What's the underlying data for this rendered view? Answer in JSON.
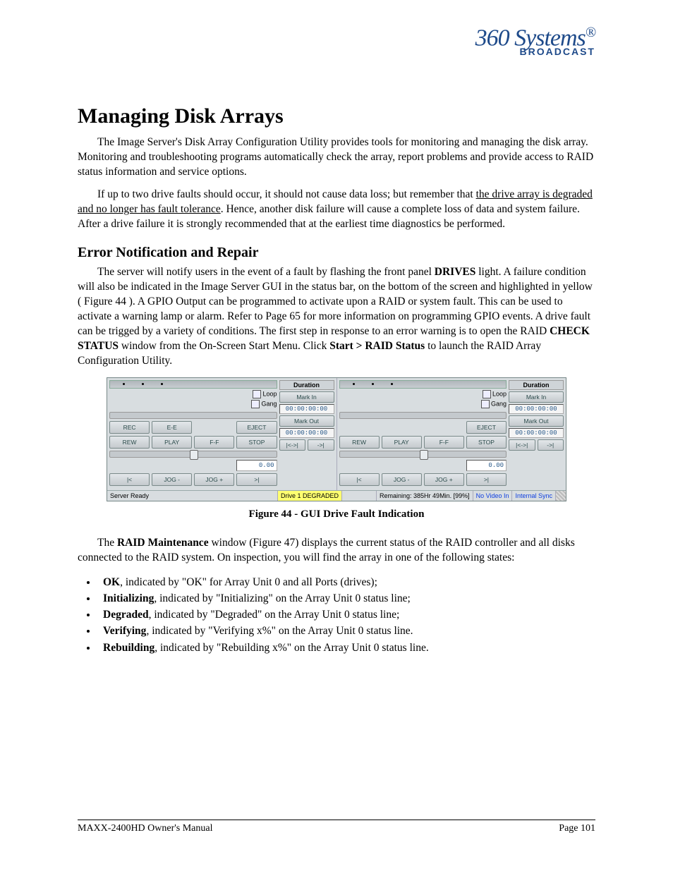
{
  "logo": {
    "script": "360 Systems",
    "reg": "®",
    "broadcast": "BROADCAST"
  },
  "h1": "Managing Disk Arrays",
  "p1a": "The Image Server's Disk Array Configuration Utility provides tools for monitoring and managing the disk array.  Monitoring and troubleshooting programs automatically check the array, report problems and provide access to RAID status information and service options.",
  "p2a": "If up to two drive faults should occur, it should not cause data loss; but remember that ",
  "p2u": "the drive array is degraded and no longer has fault tolerance",
  "p2b": ".  Hence, another disk failure will cause a complete loss of data and system failure.  After a drive failure it is strongly recommended that at the earliest time diagnostics be performed.",
  "h2": "Error Notification and Repair",
  "p3a": "The server will notify users in the event of a fault by flashing the front panel ",
  "p3b1": "DRIVES",
  "p3c": " light.  A failure condition will also be indicated in the Image Server GUI in the status bar, on the bottom of the screen and highlighted in yellow ( Figure 44 ).  A GPIO Output can be programmed to activate upon a RAID or system fault. This can be used to activate a warning lamp or alarm. Refer to Page 65 for more information on programming GPIO events. A drive fault can be trigged by a variety of conditions.  The first step in response to an error warning is to open the RAID ",
  "p3b2": "CHECK STATUS",
  "p3d": " window from the On-Screen Start Menu.  Click ",
  "p3b3": "Start  >  RAID Status",
  "p3e": " to launch the RAID Array Configuration Utility.",
  "fig_caption": "Figure 44 - GUI Drive Fault Indication",
  "gui": {
    "duration_label": "Duration",
    "loop": "Loop",
    "gang": "Gang",
    "mark_in": "Mark In",
    "mark_out": "Mark Out",
    "tc": "00:00:00:00",
    "jog_val": "0.00",
    "btns": {
      "rec": "REC",
      "ee": "E-E",
      "eject": "EJECT",
      "rew": "REW",
      "play": "PLAY",
      "ff": "F-F",
      "stop": "STOP",
      "start": "|<",
      "jogm": "JOG -",
      "jogp": "JOG +",
      "end": ">|",
      "mark_back": "|<->|",
      "mark_fwd": "->|"
    },
    "status": {
      "ready": "Server Ready",
      "degraded": "Drive 1 DEGRADED",
      "remaining": "Remaining: 385Hr 49Min. [99%]",
      "novideo": "No Video In",
      "sync": "Internal Sync"
    }
  },
  "p4a": "The ",
  "p4b": "RAID Maintenance",
  "p4c": " window (Figure 47) displays the current status of the RAID controller and all disks connected to the RAID system.  On inspection, you will find the array in one of the following states:",
  "states": {
    "s1b": "OK",
    "s1": ", indicated by \"OK\" for Array Unit 0 and all Ports (drives);",
    "s2b": "Initializing",
    "s2": ", indicated by \"Initializing\" on the Array Unit 0 status line;",
    "s3b": "Degraded",
    "s3": ", indicated by \"Degraded\" on the Array Unit 0 status line;",
    "s4b": "Verifying",
    "s4": ", indicated by \"Verifying x%\" on the Array Unit 0 status line.",
    "s5b": "Rebuilding",
    "s5": ", indicated by \"Rebuilding x%\" on the Array Unit 0 status line."
  },
  "footer": {
    "left": "MAXX-2400HD Owner's Manual",
    "right": "Page 101"
  }
}
